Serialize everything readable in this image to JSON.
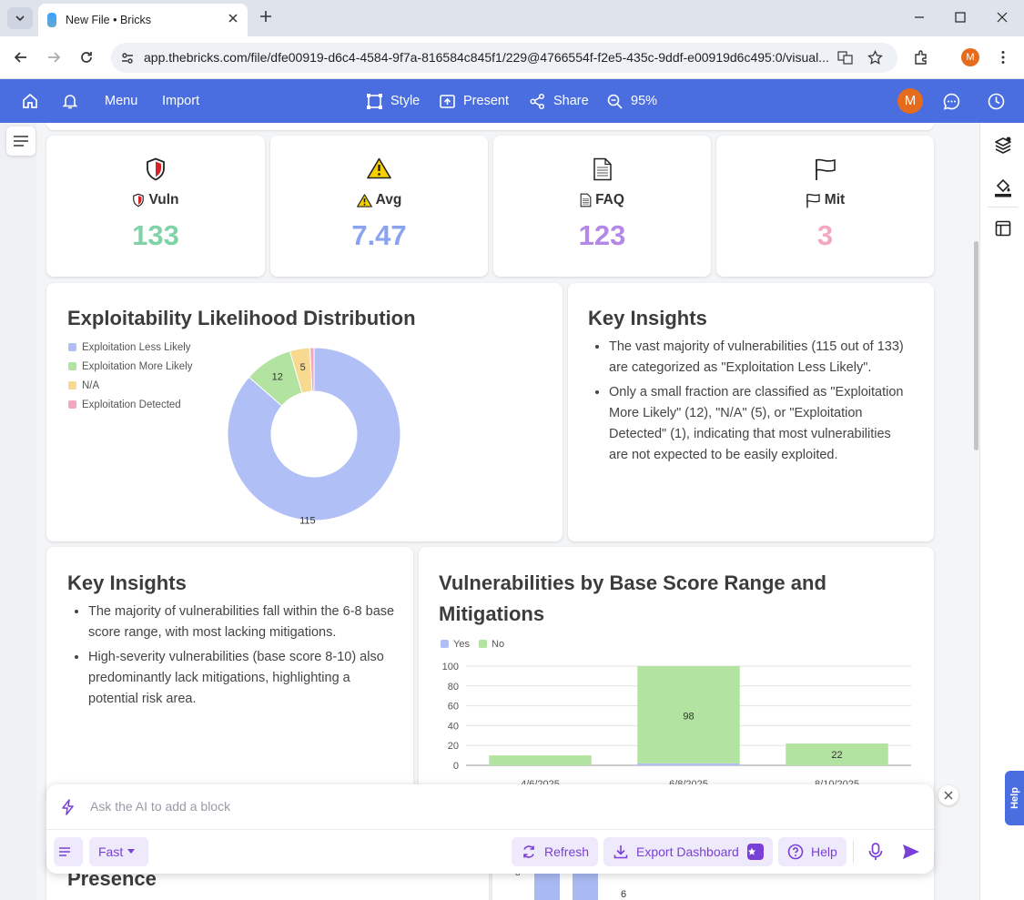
{
  "browser": {
    "tab_title": "New File • Bricks",
    "url": "app.thebricks.com/file/dfe00919-d6c4-4584-9f7a-816584c845f1/229@4766554f-f2e5-435c-9ddf-e00919d6c495:0/visual...",
    "profile_initial": "M"
  },
  "toolbar": {
    "menu": "Menu",
    "import": "Import",
    "style": "Style",
    "present": "Present",
    "share": "Share",
    "zoom": "95%",
    "avatar_initial": "M"
  },
  "kpis": [
    {
      "label": "Vuln",
      "value": "133",
      "color": "#7fd3a7",
      "icon": "shield-icon"
    },
    {
      "label": "Avg",
      "value": "7.47",
      "color": "#8aa3ee",
      "icon": "warning-icon"
    },
    {
      "label": "FAQ",
      "value": "123",
      "color": "#b488e6",
      "icon": "document-icon"
    },
    {
      "label": "Mit",
      "value": "3",
      "color": "#f4a7c2",
      "icon": "flag-icon"
    }
  ],
  "donut_card": {
    "title": "Exploitability Likelihood Distribution"
  },
  "insights1": {
    "title": "Key Insights",
    "bullets": [
      "The vast majority of vulnerabilities (115 out of 133) are categorized as \"Exploitation Less Likely\".",
      "Only a small fraction are classified as \"Exploitation More Likely\" (12), \"N/A\" (5), or \"Exploitation Detected\" (1), indicating that most vulnerabilities are not expected to be easily exploited."
    ]
  },
  "insights2": {
    "title": "Key Insights",
    "bullets": [
      "The majority of vulnerabilities fall within the 6-8 base score range, with most lacking mitigations.",
      "High-severity vulnerabilities (base score 8-10) also predominantly lack mitigations, highlighting a potential risk area."
    ]
  },
  "bar_card": {
    "title_line1": "Vulnerabilities by Base Score Range and",
    "title_line2": "Mitigations"
  },
  "partial_card": {
    "title": "Presence",
    "tick": "8",
    "label": "6"
  },
  "ai": {
    "placeholder": "Ask the AI to add a block",
    "mode": "Fast",
    "refresh": "Refresh",
    "export": "Export Dashboard",
    "help": "Help"
  },
  "help_tab": "Help",
  "chart_data": [
    {
      "type": "pie",
      "categories": [
        "Exploitation Less Likely",
        "Exploitation More Likely",
        "N/A",
        "Exploitation Detected"
      ],
      "values": [
        115,
        12,
        5,
        1
      ],
      "colors": [
        "#b0bff5",
        "#b3e3a0",
        "#f7d98f",
        "#f4a7c2"
      ],
      "labels": [
        "115",
        "12",
        "5",
        ""
      ],
      "legend": "left"
    },
    {
      "type": "bar",
      "stacked": true,
      "categories": [
        "4/6/2025",
        "6/8/2025",
        "8/10/2025"
      ],
      "series": [
        {
          "name": "Yes",
          "values": [
            0,
            2,
            0
          ],
          "color": "#b0bff5"
        },
        {
          "name": "No",
          "values": [
            10,
            98,
            22
          ],
          "color": "#b3e3a0"
        }
      ],
      "data_labels": [
        "",
        "98",
        "22"
      ],
      "ylim": [
        0,
        100
      ],
      "yticks": [
        "100",
        "80",
        "60",
        "40",
        "20",
        "0"
      ],
      "grid": true,
      "legend": "top-left"
    }
  ]
}
